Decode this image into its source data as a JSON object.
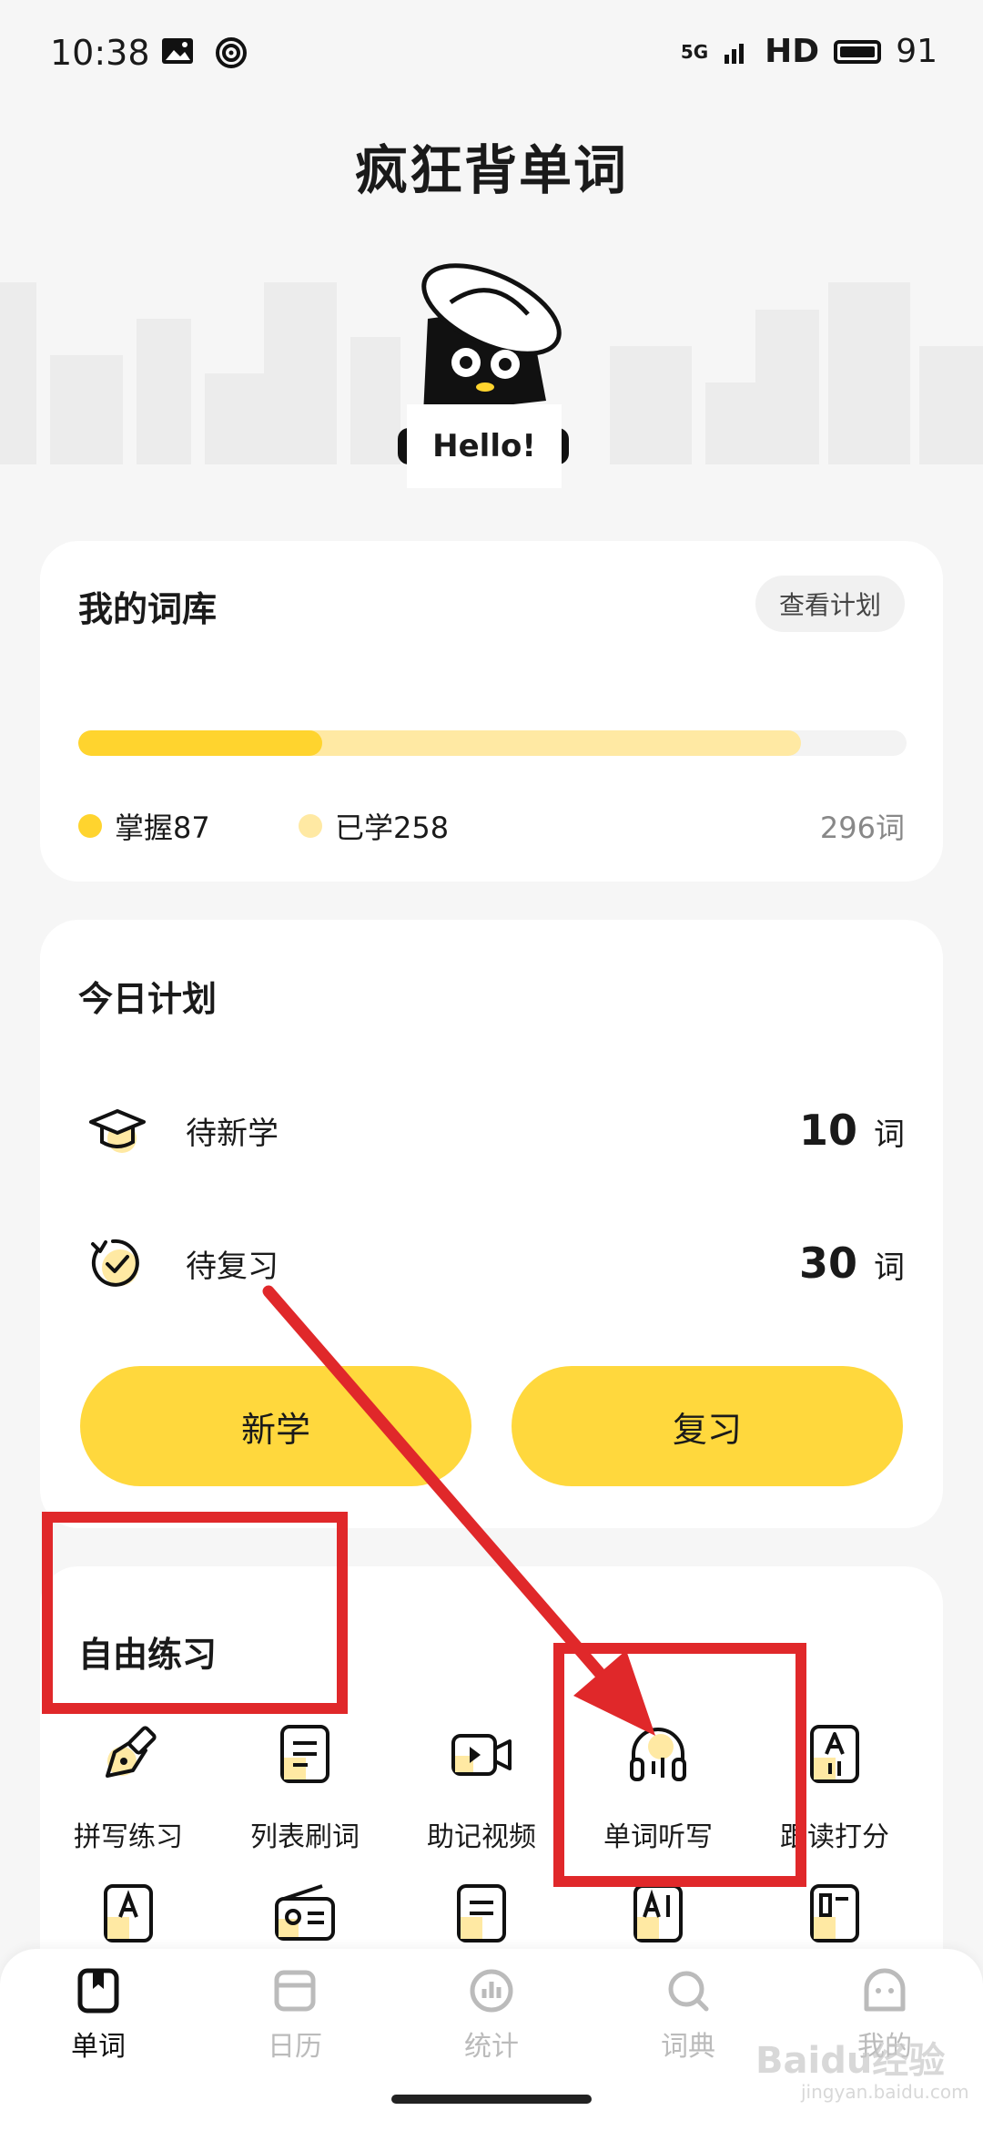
{
  "status_bar": {
    "time": "10:38",
    "network": "5G",
    "hd": "HD",
    "battery": "91"
  },
  "app": {
    "title": "疯狂背单词",
    "hello": "Hello!"
  },
  "library": {
    "title": "我的词库",
    "plan_button": "查看计划",
    "mastered_label": "掌握87",
    "learned_label": "已学258",
    "total_label": "296词",
    "mastered_fraction": 0.294,
    "learned_fraction": 0.872,
    "mastered_color": "#ffd42e",
    "learned_color": "#ffe9a3"
  },
  "today_plan": {
    "title": "今日计划",
    "rows": [
      {
        "label": "待新学",
        "count": "10",
        "unit": "词",
        "icon": "graduation-cap-icon"
      },
      {
        "label": "待复习",
        "count": "30",
        "unit": "词",
        "icon": "review-clock-icon"
      }
    ],
    "new_button": "新学",
    "review_button": "复习"
  },
  "free_practice": {
    "title": "自由练习",
    "items": [
      {
        "label": "拼写练习",
        "icon": "pen-nib-icon"
      },
      {
        "label": "列表刷词",
        "icon": "list-icon"
      },
      {
        "label": "助记视频",
        "icon": "video-icon"
      },
      {
        "label": "单词听写",
        "icon": "headphones-icon"
      },
      {
        "label": "跟读打分",
        "icon": "read-aloud-icon"
      }
    ]
  },
  "bottom_nav": [
    {
      "label": "单词",
      "icon": "word-book-icon",
      "active": true
    },
    {
      "label": "日历",
      "icon": "calendar-icon",
      "active": false
    },
    {
      "label": "统计",
      "icon": "stats-icon",
      "active": false
    },
    {
      "label": "词典",
      "icon": "dictionary-search-icon",
      "active": false
    },
    {
      "label": "我的",
      "icon": "profile-icon",
      "active": false
    }
  ],
  "watermark": {
    "text": "Baidu经验",
    "sub": "jingyan.baidu.com"
  },
  "annotation_color": "#e0282a"
}
